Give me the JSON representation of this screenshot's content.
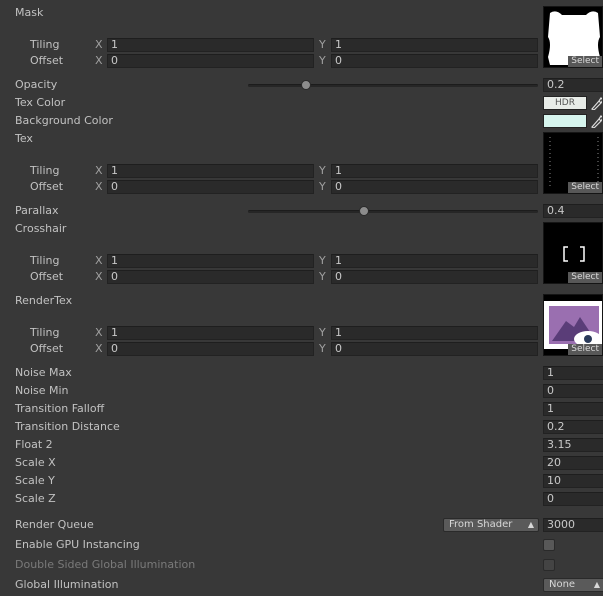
{
  "mask": {
    "label": "Mask",
    "tiling_label": "Tiling",
    "offset_label": "Offset",
    "tiling_x": "1",
    "tiling_y": "1",
    "offset_x": "0",
    "offset_y": "0",
    "select_label": "Select"
  },
  "axis": {
    "x": "X",
    "y": "Y"
  },
  "opacity": {
    "label": "Opacity",
    "value": "0.2",
    "fraction": 0.2
  },
  "tex_color": {
    "label": "Tex Color",
    "hdr_label": "HDR",
    "color": "#e8ece8"
  },
  "background_color": {
    "label": "Background Color",
    "color": "#d6f5ee"
  },
  "tex": {
    "label": "Tex",
    "tiling_label": "Tiling",
    "offset_label": "Offset",
    "tiling_x": "1",
    "tiling_y": "1",
    "offset_x": "0",
    "offset_y": "0",
    "select_label": "Select"
  },
  "parallax": {
    "label": "Parallax",
    "value": "0.4",
    "fraction": 0.4
  },
  "crosshair": {
    "label": "Crosshair",
    "tiling_label": "Tiling",
    "offset_label": "Offset",
    "tiling_x": "1",
    "tiling_y": "1",
    "offset_x": "0",
    "offset_y": "0",
    "select_label": "Select"
  },
  "rendertex": {
    "label": "RenderTex",
    "tiling_label": "Tiling",
    "offset_label": "Offset",
    "tiling_x": "1",
    "tiling_y": "1",
    "offset_x": "0",
    "offset_y": "0",
    "select_label": "Select"
  },
  "floats": [
    {
      "label": "Noise Max",
      "value": "1"
    },
    {
      "label": "Noise Min",
      "value": "0"
    },
    {
      "label": "Transition Falloff",
      "value": "1"
    },
    {
      "label": "Transition Distance",
      "value": "0.2"
    },
    {
      "label": "Float 2",
      "value": "3.15"
    },
    {
      "label": "Scale X",
      "value": "20"
    },
    {
      "label": "Scale Y",
      "value": "10"
    },
    {
      "label": "Scale Z",
      "value": "0"
    }
  ],
  "render_queue": {
    "label": "Render Queue",
    "dropdown": "From Shader",
    "value": "3000"
  },
  "gpu_instancing": {
    "label": "Enable GPU Instancing",
    "checked": false
  },
  "double_sided_gi": {
    "label": "Double Sided Global Illumination",
    "checked": false
  },
  "global_illumination": {
    "label": "Global Illumination",
    "dropdown": "None"
  }
}
